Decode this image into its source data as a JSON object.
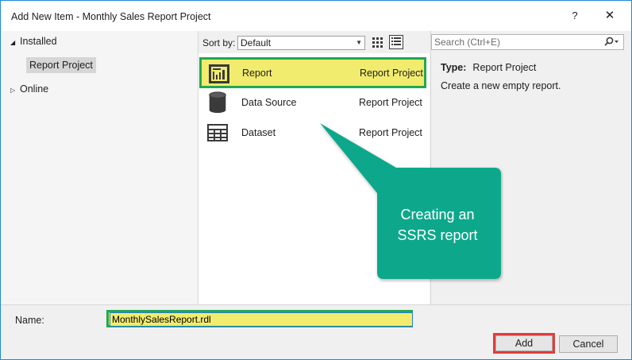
{
  "window": {
    "title": "Add New Item - Monthly Sales Report Project",
    "help_label": "?",
    "close_label": "✕"
  },
  "tree": {
    "installed_label": "Installed",
    "report_project_label": "Report Project",
    "online_label": "Online"
  },
  "toolbar": {
    "sort_label": "Sort by:",
    "sort_value": "Default",
    "sort_options_visible": [
      "Default"
    ]
  },
  "items": [
    {
      "name": "Report",
      "type": "Report Project",
      "icon": "report-icon",
      "selected": true
    },
    {
      "name": "Data Source",
      "type": "Report Project",
      "icon": "data-source-icon",
      "selected": false
    },
    {
      "name": "Dataset",
      "type": "Report Project",
      "icon": "dataset-icon",
      "selected": false
    }
  ],
  "search": {
    "placeholder": "Search (Ctrl+E)"
  },
  "details": {
    "type_label": "Type:",
    "type_value": "Report Project",
    "description": "Create a new empty report."
  },
  "callout": {
    "line1": "Creating an",
    "line2": "SSRS report",
    "color": "#0aa88b"
  },
  "bottom": {
    "name_label": "Name:",
    "name_value": "MonthlySalesReport.rdl",
    "add_label": "Add",
    "cancel_label": "Cancel"
  },
  "colors": {
    "window_border": "#1f8ad6",
    "highlight_fill": "#f1ec6e",
    "highlight_border": "#22a84f",
    "add_outline": "#e03c3c"
  }
}
